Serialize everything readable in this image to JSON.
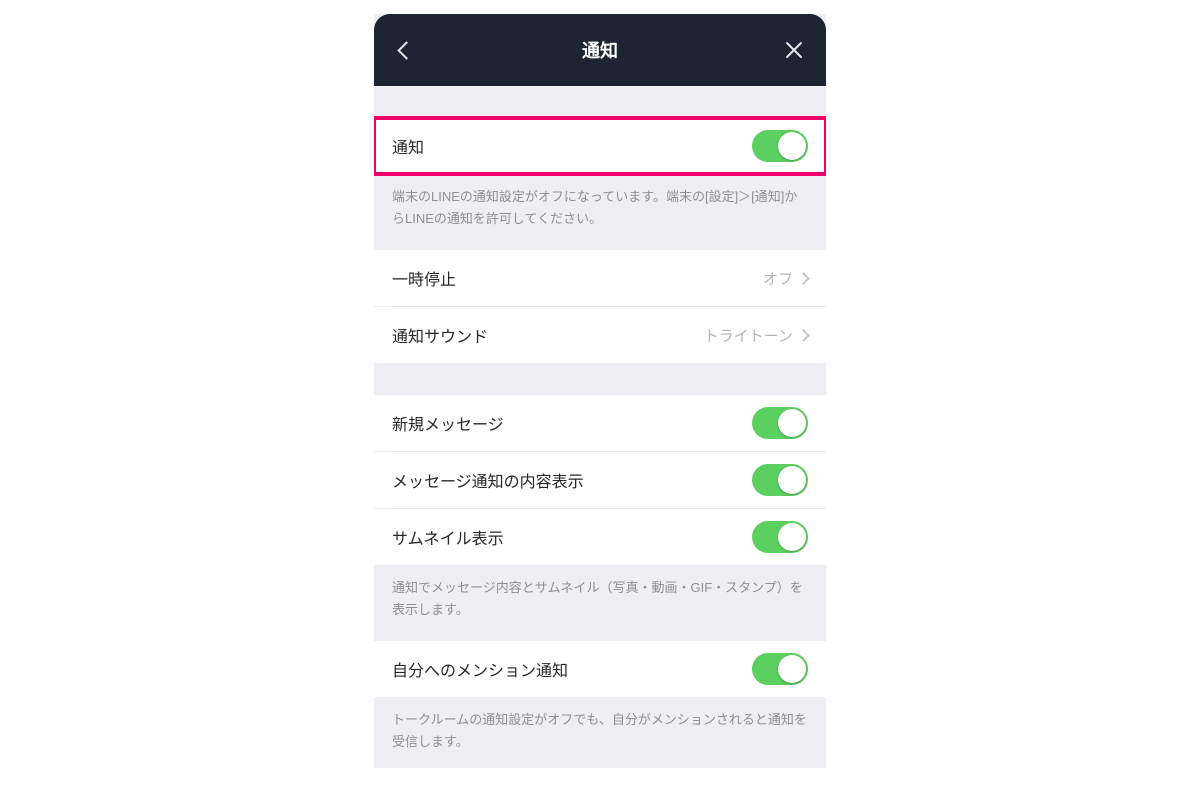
{
  "nav": {
    "title": "通知"
  },
  "rows": {
    "notifications": {
      "label": "通知",
      "helper": "端末のLINEの通知設定がオフになっています。端末の[設定]＞[通知]からLINEの通知を許可してください。",
      "on": true
    },
    "pause": {
      "label": "一時停止",
      "value": "オフ"
    },
    "sound": {
      "label": "通知サウンド",
      "value": "トライトーン"
    },
    "newMessage": {
      "label": "新規メッセージ",
      "on": true
    },
    "preview": {
      "label": "メッセージ通知の内容表示",
      "on": true
    },
    "thumbnail": {
      "label": "サムネイル表示",
      "on": true
    },
    "thumbnailHelper": "通知でメッセージ内容とサムネイル（写真・動画・GIF・スタンプ）を表示します。",
    "mention": {
      "label": "自分へのメンション通知",
      "on": true,
      "helper": "トークルームの通知設定がオフでも、自分がメンションされると通知を受信します。"
    }
  }
}
